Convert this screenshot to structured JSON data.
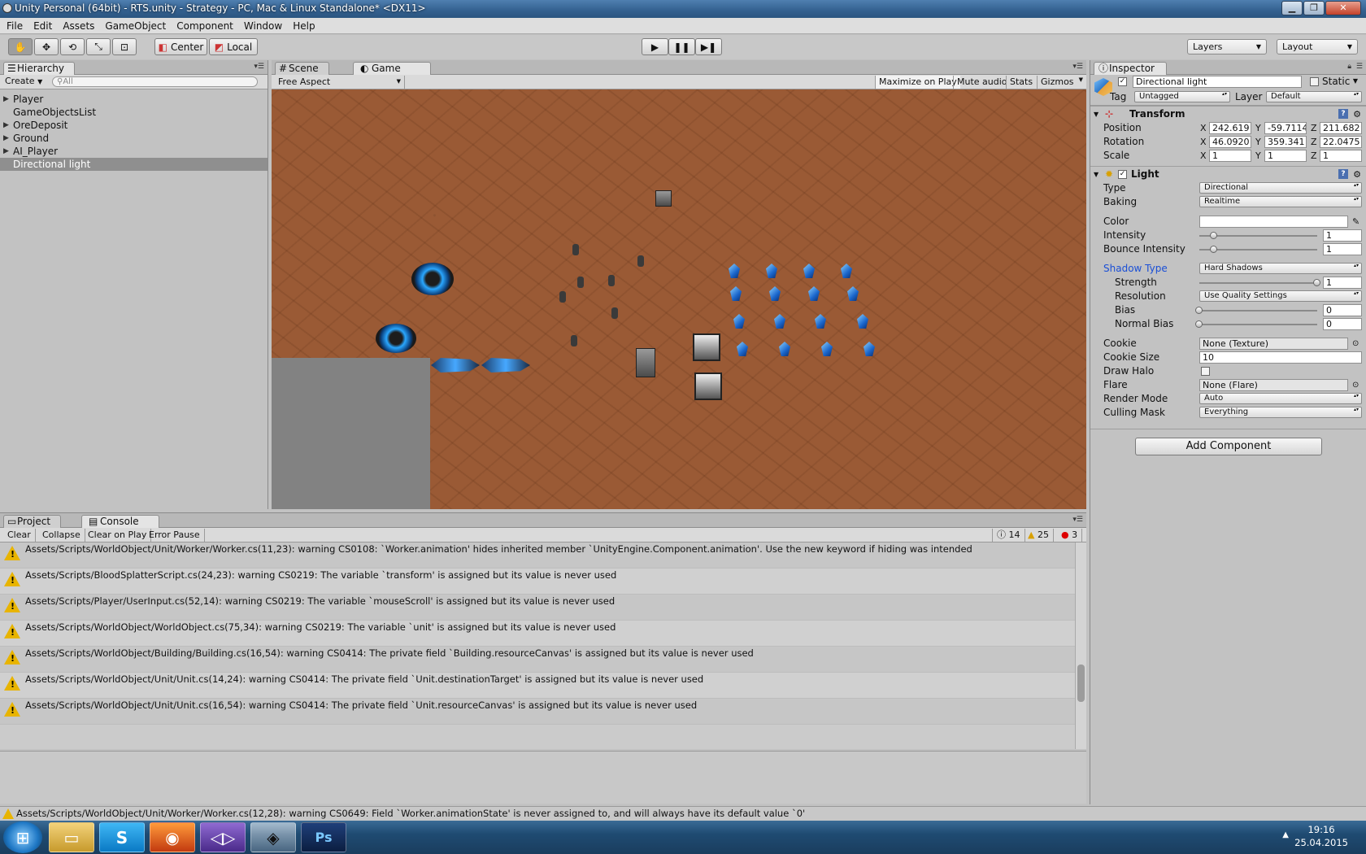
{
  "window": {
    "title": "Unity Personal (64bit) - RTS.unity - Strategy - PC, Mac & Linux Standalone* <DX11>"
  },
  "menu": [
    "File",
    "Edit",
    "Assets",
    "GameObject",
    "Component",
    "Window",
    "Help"
  ],
  "toolbar": {
    "pivot": "Center",
    "space": "Local",
    "layers": "Layers",
    "layout": "Layout"
  },
  "hierarchy": {
    "tab": "Hierarchy",
    "create": "Create",
    "search_placeholder": "All",
    "items": [
      {
        "label": "Player",
        "expandable": true
      },
      {
        "label": "GameObjectsList",
        "expandable": false
      },
      {
        "label": "OreDeposit",
        "expandable": true
      },
      {
        "label": "Ground",
        "expandable": true
      },
      {
        "label": "AI_Player",
        "expandable": true
      },
      {
        "label": "Directional light",
        "expandable": false,
        "selected": true
      }
    ]
  },
  "scene_tabs": {
    "scene": "Scene",
    "game": "Game"
  },
  "game_bar": {
    "aspect": "Free Aspect",
    "maximize": "Maximize on Play",
    "mute": "Mute audio",
    "stats": "Stats",
    "gizmos": "Gizmos"
  },
  "inspector": {
    "tab": "Inspector",
    "object_name": "Directional light",
    "static": "Static",
    "tag_label": "Tag",
    "tag": "Untagged",
    "layer_label": "Layer",
    "layer": "Default",
    "transform": {
      "title": "Transform",
      "position": {
        "label": "Position",
        "x": "242.619",
        "y": "-59.7114",
        "z": "211.682"
      },
      "rotation": {
        "label": "Rotation",
        "x": "46.0920",
        "y": "359.341",
        "z": "22.0475"
      },
      "scale": {
        "label": "Scale",
        "x": "1",
        "y": "1",
        "z": "1"
      }
    },
    "light": {
      "title": "Light",
      "type_label": "Type",
      "type": "Directional",
      "baking_label": "Baking",
      "baking": "Realtime",
      "color_label": "Color",
      "intensity_label": "Intensity",
      "intensity": "1",
      "intensity_fraction": 0.125,
      "bounce_label": "Bounce Intensity",
      "bounce": "1",
      "bounce_fraction": 0.125,
      "shadow_type_label": "Shadow Type",
      "shadow_type": "Hard Shadows",
      "strength_label": "Strength",
      "strength": "1",
      "strength_fraction": 1.0,
      "resolution_label": "Resolution",
      "resolution": "Use Quality Settings",
      "bias_label": "Bias",
      "bias": "0",
      "bias_fraction": 0.0,
      "normal_bias_label": "Normal Bias",
      "normal_bias": "0",
      "normal_bias_fraction": 0.0,
      "cookie_label": "Cookie",
      "cookie": "None (Texture)",
      "cookie_size_label": "Cookie Size",
      "cookie_size": "10",
      "draw_halo_label": "Draw Halo",
      "flare_label": "Flare",
      "flare": "None (Flare)",
      "render_mode_label": "Render Mode",
      "render_mode": "Auto",
      "culling_mask_label": "Culling Mask",
      "culling_mask": "Everything"
    },
    "add_component": "Add Component"
  },
  "console": {
    "project_tab": "Project",
    "console_tab": "Console",
    "buttons": [
      "Clear",
      "Collapse",
      "Clear on Play",
      "Error Pause"
    ],
    "counts": {
      "info": "14",
      "warnings": "25",
      "errors": "3"
    },
    "messages": [
      "Assets/Scripts/WorldObject/Unit/Worker/Worker.cs(11,23): warning CS0108: `Worker.animation' hides inherited member `UnityEngine.Component.animation'. Use the new keyword if hiding was intended",
      "Assets/Scripts/BloodSplatterScript.cs(24,23): warning CS0219: The variable `transform' is assigned but its value is never used",
      "Assets/Scripts/Player/UserInput.cs(52,14): warning CS0219: The variable `mouseScroll' is assigned but its value is never used",
      "Assets/Scripts/WorldObject/WorldObject.cs(75,34): warning CS0219: The variable `unit' is assigned but its value is never used",
      "Assets/Scripts/WorldObject/Building/Building.cs(16,54): warning CS0414: The private field `Building.resourceCanvas' is assigned but its value is never used",
      "Assets/Scripts/WorldObject/Unit/Unit.cs(14,24): warning CS0414: The private field `Unit.destinationTarget' is assigned but its value is never used",
      "Assets/Scripts/WorldObject/Unit/Unit.cs(16,54): warning CS0414: The private field `Unit.resourceCanvas' is assigned but its value is never used"
    ]
  },
  "status": "Assets/Scripts/WorldObject/Unit/Worker/Worker.cs(12,28): warning CS0649: Field `Worker.animationState' is never assigned to, and will always have its default value `0'",
  "taskbar": {
    "time": "19:16",
    "date": "25.04.2015"
  },
  "colors": {
    "shadow_type_label": "#1a4fd6",
    "warning": "#e8b400",
    "selection": "#8f8f8f"
  }
}
